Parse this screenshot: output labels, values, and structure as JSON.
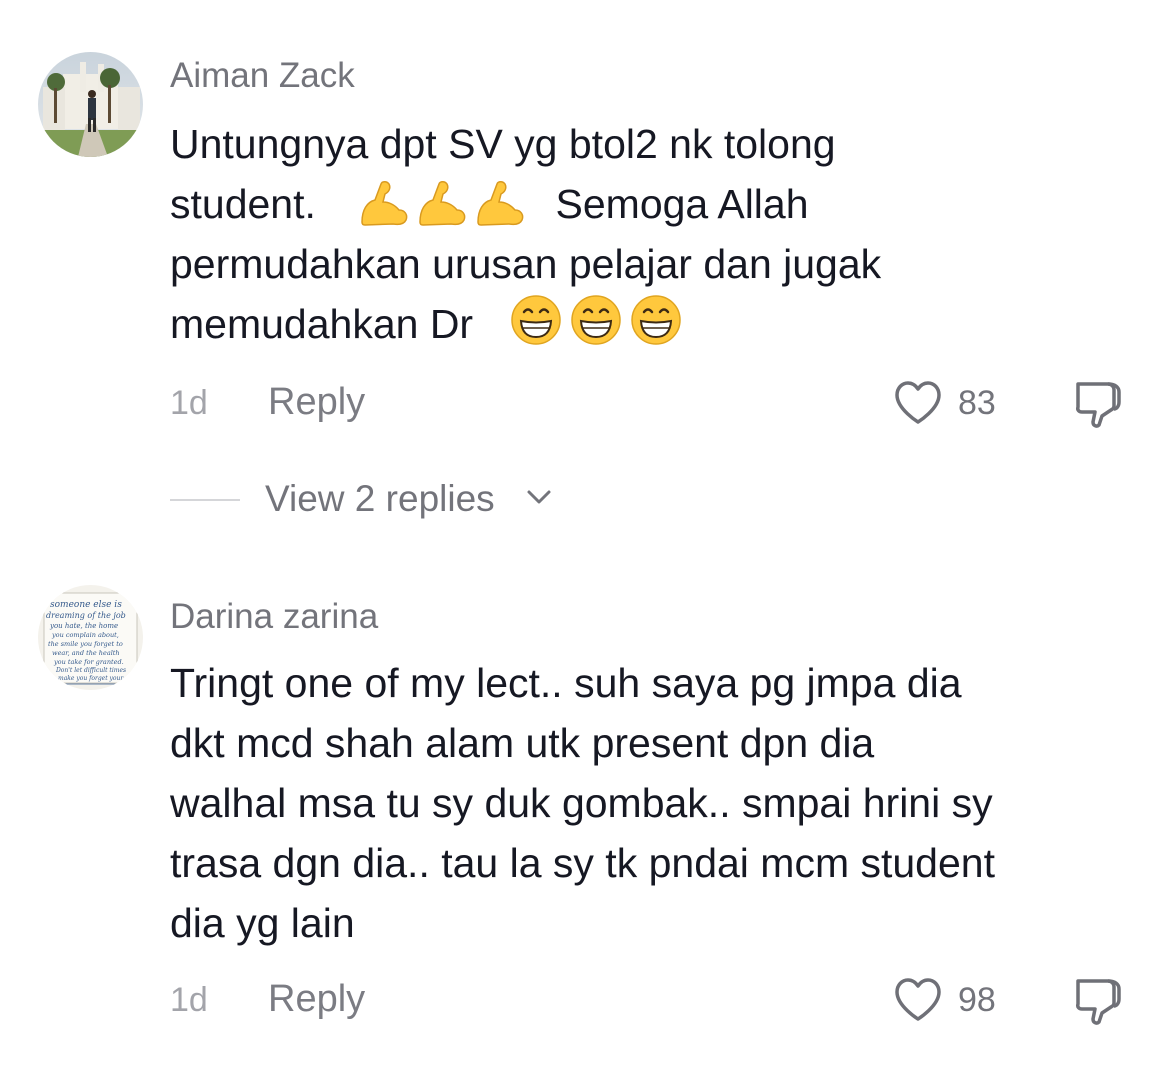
{
  "comments": [
    {
      "username": "Aiman Zack",
      "text_lines": [
        "Untungnya dpt SV yg btol2 nk tolong",
        "student.",
        "Semoga Allah",
        "permudahkan urusan pelajar dan jugak",
        "memudahkan Dr"
      ],
      "emojis": [
        "flexed-biceps-emoji",
        "grinning-face-emoji"
      ],
      "time": "1d",
      "reply_label": "Reply",
      "likes": "83",
      "view_replies_label": "View 2 replies"
    },
    {
      "username": "Darina zarina",
      "text_lines": [
        "Tringt one of my lect.. suh saya pg jmpa dia",
        "dkt mcd shah alam utk present dpn dia",
        "walhal msa tu sy duk gombak.. smpai hrini sy",
        "trasa dgn dia.. tau la sy tk pndai mcm student",
        "dia yg lain"
      ],
      "avatar_text": "someone else is dreaming of the job you hate, the home you complain about, the smile you forget to wear, and the health you take for granted. Don't let difficult times make you forget your blessings",
      "time": "1d",
      "reply_label": "Reply",
      "likes": "98"
    }
  ],
  "icons": {
    "like": "heart-outline-icon",
    "dislike": "thumbs-down-icon",
    "expand": "chevron-down-icon"
  },
  "colors": {
    "text": "#161823",
    "secondary": "#73747b",
    "muted": "#a3a4aa",
    "emoji_yellow": "#ffc83d"
  }
}
